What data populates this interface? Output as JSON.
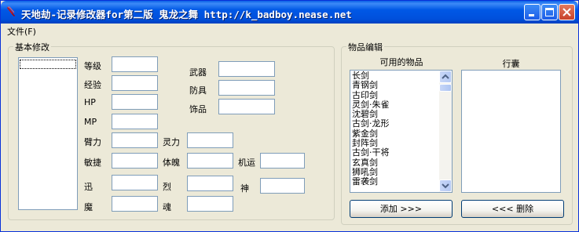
{
  "window": {
    "title": "天地劫-记录修改器for第二版 鬼龙之舞 http://k_badboy.nease.net",
    "minimize_icon": "minimize-icon",
    "maximize_icon": "maximize-icon",
    "close_icon": "close-icon",
    "app_icon": "sword-app-icon"
  },
  "menu": {
    "file": "文件(F)"
  },
  "basic": {
    "group_title": "基本修改",
    "level": "等级",
    "exp": "经验",
    "hp": "HP",
    "mp": "MP",
    "arm": "臂力",
    "agility": "敏捷",
    "speed": "迅",
    "demon": "魔",
    "weapon": "武器",
    "armor": "防具",
    "accessory": "饰品",
    "spirit": "灵力",
    "physique": "体魄",
    "luck": "机运",
    "fierce": "烈",
    "god": "神",
    "soul": "魂"
  },
  "items": {
    "group_title": "物品编辑",
    "available_header": "可用的物品",
    "bag_header": "行囊",
    "available_list": [
      "长剑",
      "青钢剑",
      "古印剑",
      "灵剑·朱雀",
      "沈碧剑",
      "古剑·龙形",
      "紫金剑",
      "封阵剑",
      "古剑·干将",
      "玄真剑",
      "狮吼剑",
      "雷袭剑"
    ],
    "add_button": "添加 >>>",
    "remove_button": "<<< 删除"
  }
}
